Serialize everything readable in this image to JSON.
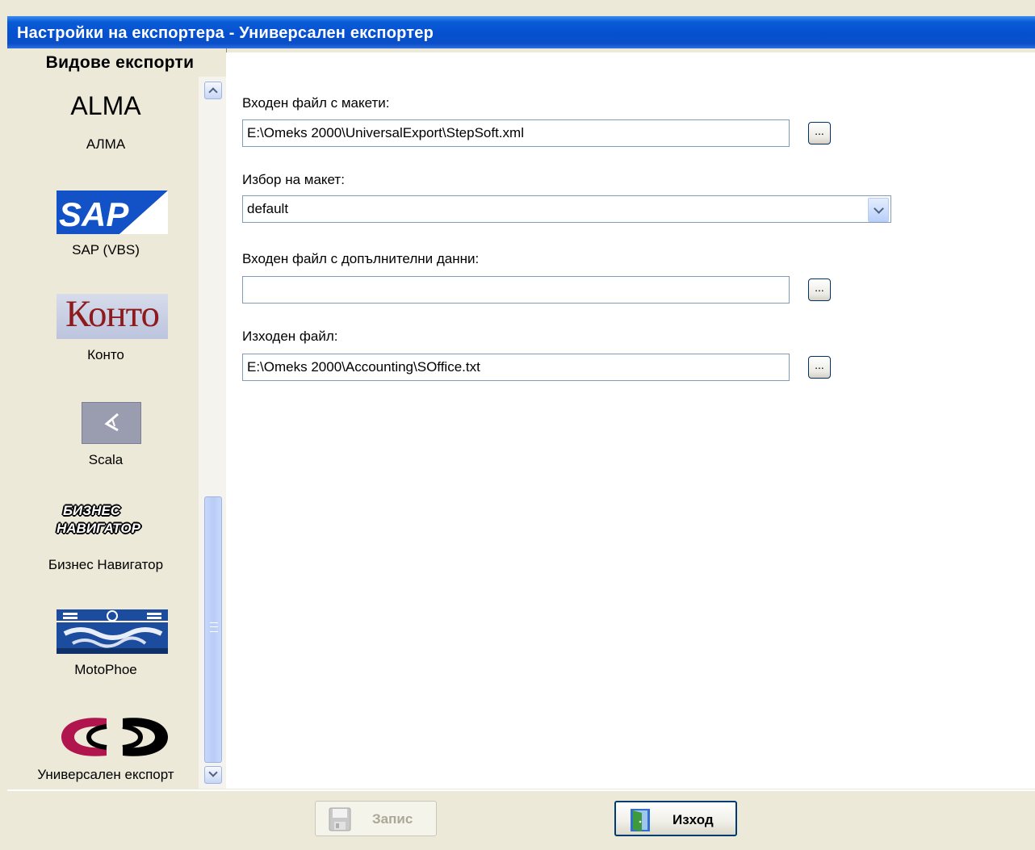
{
  "window": {
    "title": "Настройки на експортера - Универсален експортер"
  },
  "sidebar": {
    "header": "Видове експорти",
    "items": [
      {
        "logo_text": "ALMA",
        "label": "АЛМА"
      },
      {
        "logo_text": "SAP",
        "label": "SAP (VBS)"
      },
      {
        "logo_text": "Конто",
        "label": "Конто"
      },
      {
        "logo_text": "",
        "label": "Scala"
      },
      {
        "logo_line1": "БИЗНЕС",
        "logo_line2": "НАВИГАТОР",
        "label": "Бизнес Навигатор"
      },
      {
        "logo_text": "",
        "label": "MotoPhoe"
      },
      {
        "logo_text": "",
        "label": "Универсален експорт"
      }
    ]
  },
  "form": {
    "template_file_label": "Входен файл с макети:",
    "template_file_value": "E:\\Omeks 2000\\UniversalExport\\StepSoft.xml",
    "template_select_label": "Избор на макет:",
    "template_select_value": "default",
    "extra_file_label": "Входен файл с допълнителни данни:",
    "extra_file_value": "",
    "output_file_label": "Изходен файл:",
    "output_file_value": "E:\\Omeks 2000\\Accounting\\SOffice.txt",
    "browse_label": "..."
  },
  "buttons": {
    "save_label": "Запис",
    "exit_label": "Изход"
  },
  "colors": {
    "titlebar": "#0550D0",
    "window_bg": "#ECE9D8",
    "input_border": "#7F9DB9",
    "konto_red": "#8E1B1B",
    "universal_red": "#B0154E"
  }
}
